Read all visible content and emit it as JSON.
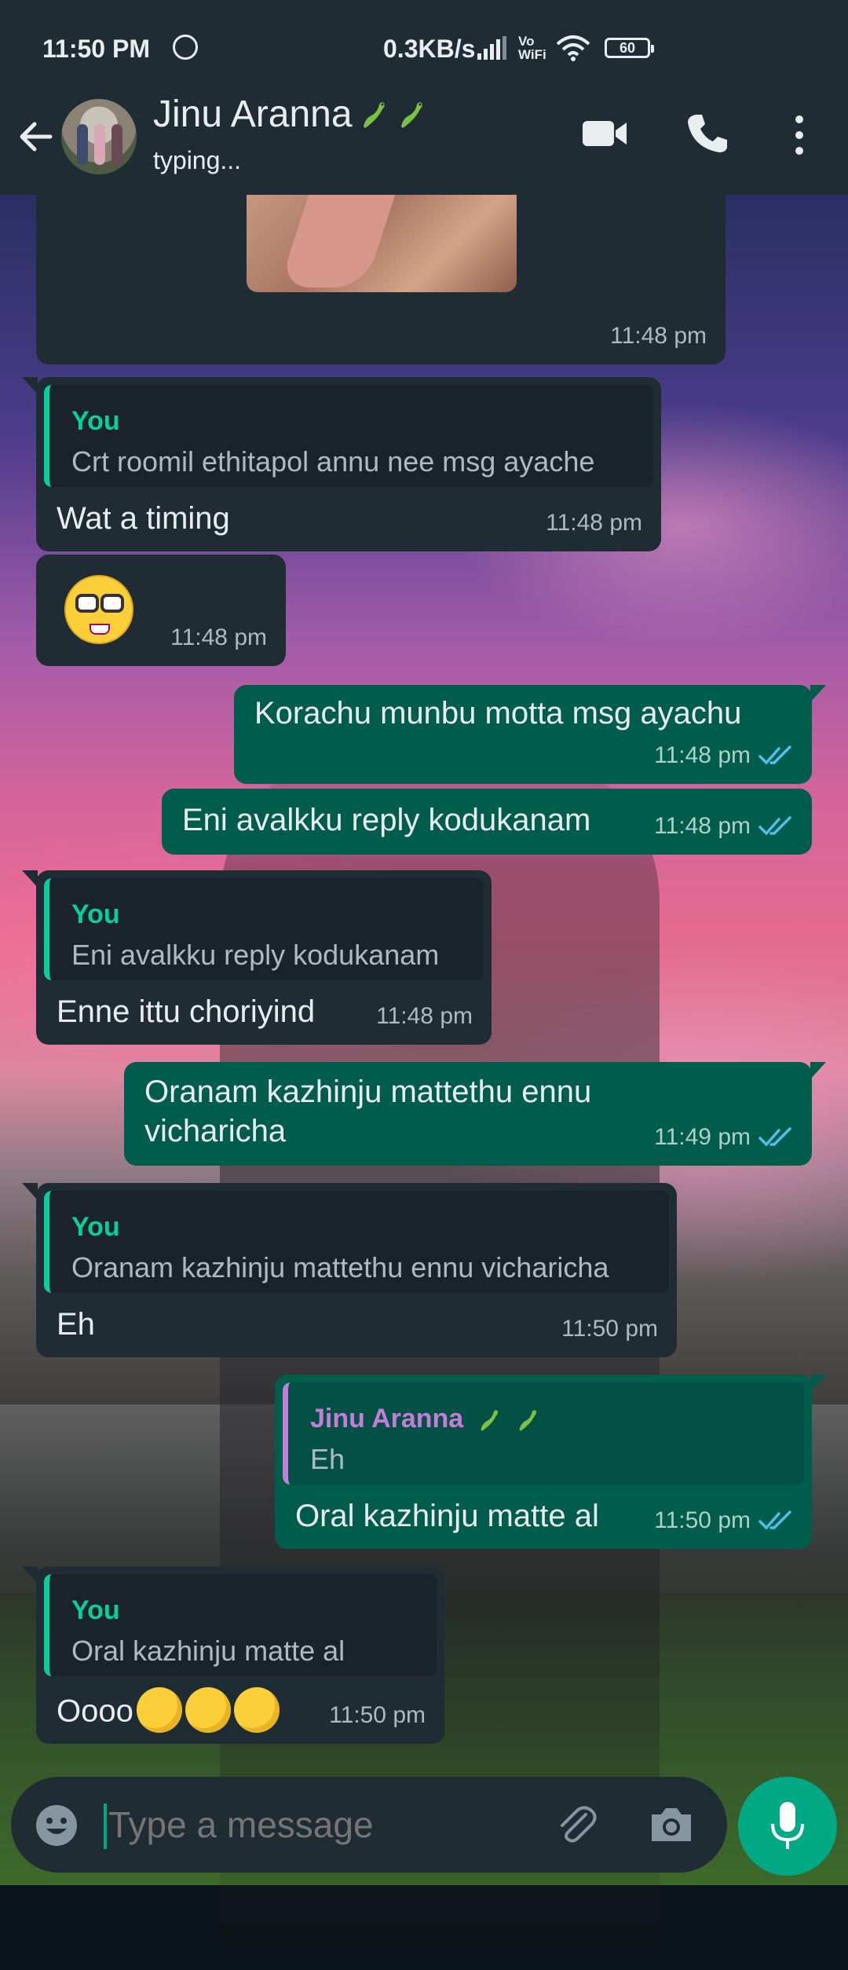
{
  "status_bar": {
    "time": "11:50 PM",
    "speed": "0.3KB/s",
    "vowifi": "Vo\nWiFi",
    "battery": "60"
  },
  "header": {
    "contact_name": "Jinu Aranna",
    "contact_emoji": "lizard-emoji x2",
    "status": "typing..."
  },
  "messages": [
    {
      "type": "image",
      "direction": "in",
      "time": "11:48 pm"
    },
    {
      "type": "reply",
      "direction": "in",
      "quote_name": "You",
      "quote_text": "Crt roomil ethitapol annu nee msg ayache",
      "text": "Wat a timing",
      "time": "11:48 pm"
    },
    {
      "type": "emoji",
      "direction": "in",
      "emoji": "nerd-face-emoji",
      "time": "11:48 pm"
    },
    {
      "type": "text",
      "direction": "out",
      "text": "Korachu munbu motta msg ayachu",
      "time": "11:48 pm",
      "read": true
    },
    {
      "type": "text",
      "direction": "out",
      "text": "Eni avalkku reply kodukanam",
      "time": "11:48 pm",
      "read": true
    },
    {
      "type": "reply",
      "direction": "in",
      "quote_name": "You",
      "quote_text": "Eni avalkku reply kodukanam",
      "text": "Enne ittu choriyind",
      "time": "11:48 pm"
    },
    {
      "type": "text",
      "direction": "out",
      "text_line1": "Oranam kazhinju mattethu ennu",
      "text_line2": "vicharicha",
      "time": "11:49 pm",
      "read": true
    },
    {
      "type": "reply",
      "direction": "in",
      "quote_name": "You",
      "quote_text": "Oranam kazhinju mattethu ennu vicharicha",
      "text": "Eh",
      "time": "11:50 pm"
    },
    {
      "type": "reply",
      "direction": "out",
      "quote_name": "Jinu Aranna",
      "quote_text": "Eh",
      "text": "Oral kazhinju matte al",
      "time": "11:50 pm",
      "read": true
    },
    {
      "type": "reply",
      "direction": "in",
      "quote_name": "You",
      "quote_text": "Oral kazhinju matte al",
      "text": "Oooo",
      "text_emojis": "rolling-on-floor-laughing-emoji x3",
      "time": "11:50 pm"
    }
  ],
  "input": {
    "placeholder": "Type a message"
  },
  "colors": {
    "header_bg": "#1f2c34",
    "incoming_bubble": "#1f2c34",
    "outgoing_bubble": "#005c4b",
    "accent": "#00a884",
    "read_ticks": "#53bdeb"
  }
}
